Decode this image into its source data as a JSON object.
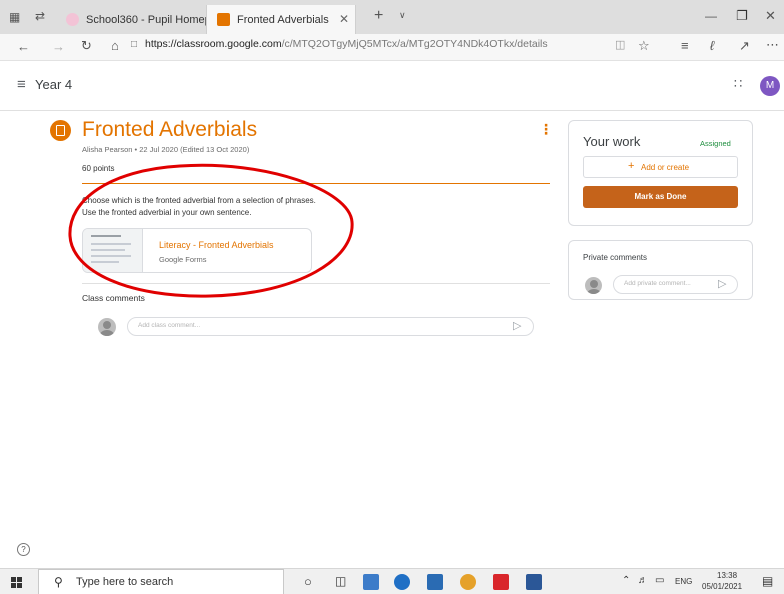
{
  "browser": {
    "tabs": [
      {
        "label": "School360 - Pupil Homepag",
        "active": false
      },
      {
        "label": "Fronted Adverbials",
        "active": true
      }
    ],
    "url_host": "https://classroom.google.com",
    "url_path": "/c/MTQ2OTgyMjQ5MTcx/a/MTg2OTY4NDk4OTkx/details"
  },
  "header": {
    "class_name": "Year 4",
    "account_initial": "M"
  },
  "assignment": {
    "title": "Fronted Adverbials",
    "meta": "Alisha Pearson • 22 Jul 2020 (Edited 13 Oct 2020)",
    "points": "60 points",
    "instructions_line1": "Choose which is the fronted adverbial from a selection of phrases.",
    "instructions_line2": "Use the fronted adverbial in your own sentence.",
    "attachment_title": "Literacy - Fronted Adverbials",
    "attachment_type": "Google Forms",
    "class_comments_label": "Class comments",
    "class_comment_placeholder": "Add class comment..."
  },
  "your_work": {
    "heading": "Your work",
    "status": "Assigned",
    "add_label": "Add or create",
    "done_label": "Mark as Done"
  },
  "private_comments": {
    "heading": "Private comments",
    "placeholder": "Add private comment..."
  },
  "taskbar": {
    "search_placeholder": "Type here to search",
    "language": "ENG",
    "time": "13:38",
    "date": "05/01/2021"
  },
  "colors": {
    "accent": "#e37400",
    "done_button": "#c5631a",
    "annotation_red": "#e00000",
    "status_green": "#1e8e3e",
    "avatar_purple": "#7e57c2"
  }
}
